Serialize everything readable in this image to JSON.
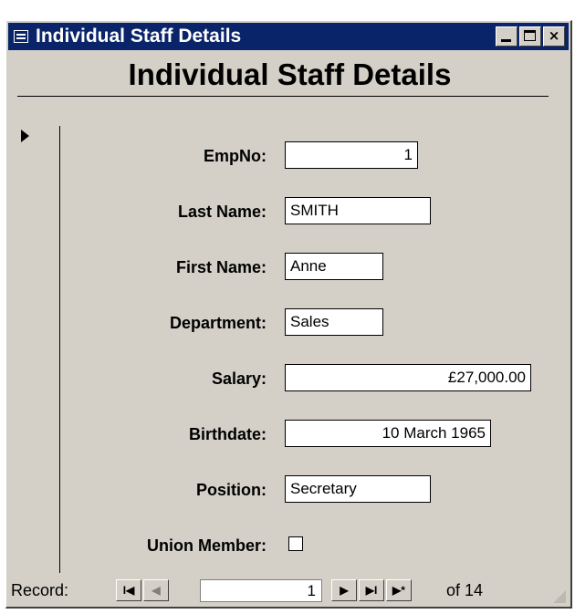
{
  "window": {
    "title": "Individual Staff Details",
    "close_glyph": "×"
  },
  "form": {
    "title": "Individual Staff Details"
  },
  "fields": {
    "empno": {
      "label": "EmpNo:",
      "value": "1"
    },
    "last_name": {
      "label": "Last Name:",
      "value": "SMITH"
    },
    "first_name": {
      "label": "First Name:",
      "value": "Anne"
    },
    "department": {
      "label": "Department:",
      "value": "Sales"
    },
    "salary": {
      "label": "Salary:",
      "value": "£27,000.00"
    },
    "birthdate": {
      "label": "Birthdate:",
      "value": "10 March 1965"
    },
    "position": {
      "label": "Position:",
      "value": "Secretary"
    },
    "union_member": {
      "label": "Union Member:",
      "checked": false
    }
  },
  "navigation": {
    "label": "Record:",
    "current": "1",
    "of_text": "of 14",
    "glyphs": {
      "first": "I◀",
      "prev": "◀",
      "next": "▶",
      "last": "▶I",
      "new": "▶*"
    }
  }
}
